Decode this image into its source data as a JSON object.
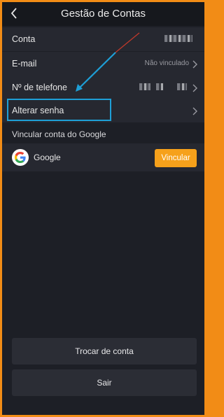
{
  "header": {
    "title": "Gestão de Contas"
  },
  "account": {
    "items": [
      {
        "label": "Conta",
        "value": ""
      },
      {
        "label": "E-mail",
        "value": "Não vinculado"
      },
      {
        "label": "Nº de telefone",
        "value": ""
      },
      {
        "label": "Alterar senha",
        "value": ""
      }
    ]
  },
  "google": {
    "section_label": "Vincular conta do Google",
    "name": "Google",
    "link_button": "Vincular"
  },
  "actions": {
    "switch_account": "Trocar de conta",
    "logout": "Sair"
  },
  "colors": {
    "accent": "#f6a11b",
    "frame_border": "#f28c16",
    "highlight": "#1e9fd6",
    "background": "#1d1f26"
  },
  "icons": [
    "back-arrow-icon",
    "chevron-right-icon",
    "google-icon"
  ]
}
